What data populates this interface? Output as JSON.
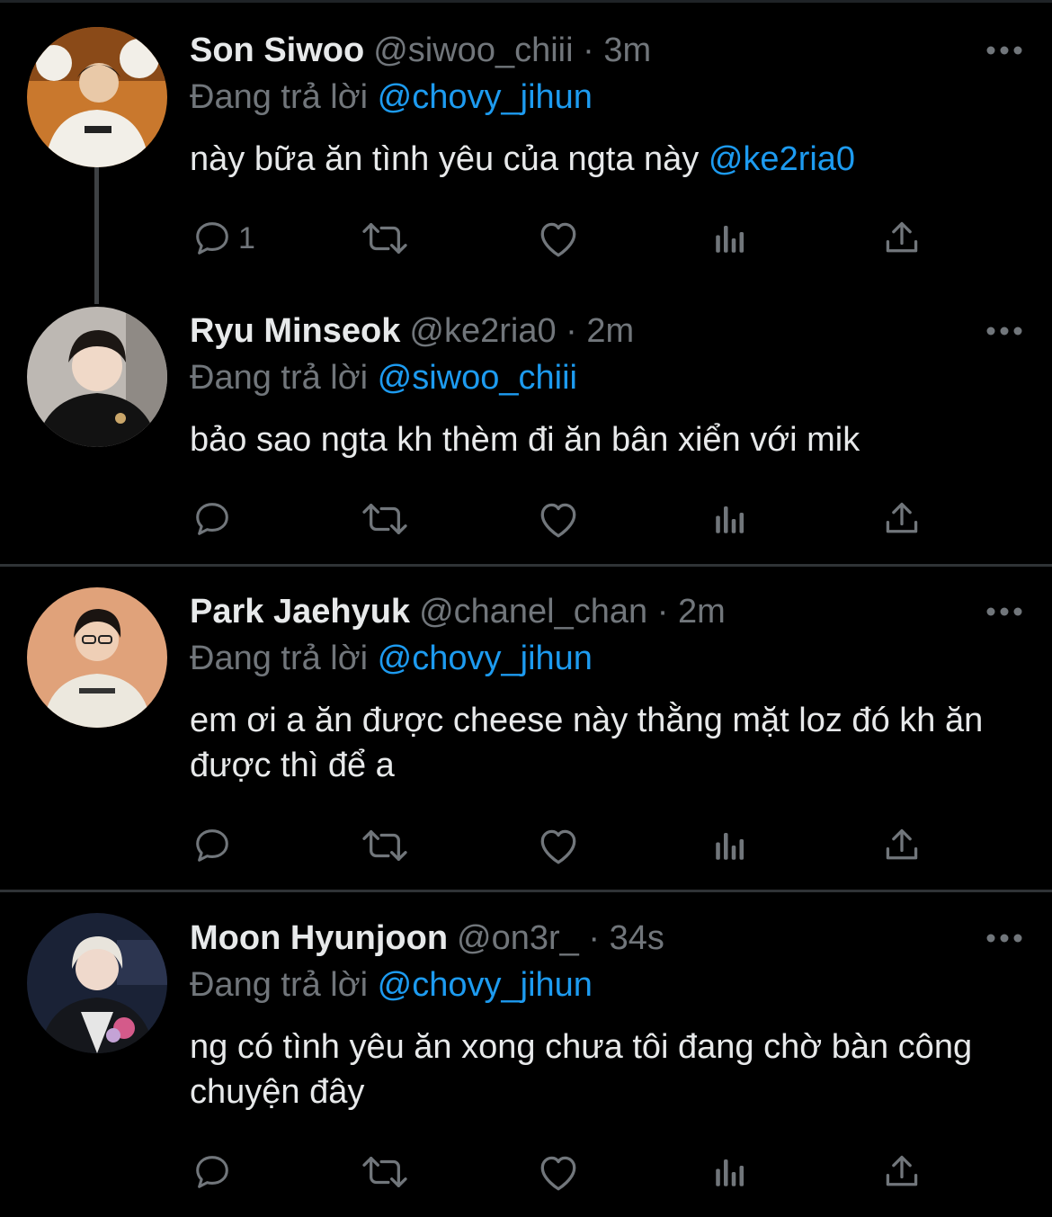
{
  "tweets": [
    {
      "name": "Son Siwoo",
      "handle": "@siwoo_chiii",
      "time": "3m",
      "replying_prefix": "Đang trả lời",
      "replying_to": "@chovy_jihun",
      "text": "này bữa ăn tình yêu của ngta này",
      "text_mention": "@ke2ria0",
      "reply_count": "1",
      "avatar_colors": {
        "bg": "#c9782d",
        "face": "#e9c9a8",
        "shirt": "#f2efe8"
      }
    },
    {
      "name": "Ryu Minseok",
      "handle": "@ke2ria0",
      "time": "2m",
      "replying_prefix": "Đang trả lời",
      "replying_to": "@siwoo_chiii",
      "text": "bảo sao ngta kh thèm đi ăn bân xiển với mik",
      "reply_count": "",
      "avatar_colors": {
        "bg": "#bdb8b3",
        "face": "#f0d9c8",
        "shirt": "#121212"
      }
    },
    {
      "name": "Park Jaehyuk",
      "handle": "@chanel_chan",
      "time": "2m",
      "replying_prefix": "Đang trả lời",
      "replying_to": "@chovy_jihun",
      "text": "em ơi a ăn được cheese này thằng mặt loz đó kh ăn được thì để a",
      "reply_count": "",
      "avatar_colors": {
        "bg": "#e0a27a",
        "face": "#efcfb6",
        "shirt": "#ece8de"
      }
    },
    {
      "name": "Moon Hyunjoon",
      "handle": "@on3r_",
      "time": "34s",
      "replying_prefix": "Đang trả lời",
      "replying_to": "@chovy_jihun",
      "text": "ng có tình yêu ăn xong chưa tôi đang chờ bàn công chuyện đây",
      "reply_count": "",
      "avatar_colors": {
        "bg": "#1a2236",
        "face": "#efd9cc",
        "shirt": "#15171c"
      }
    }
  ],
  "icons": {
    "reply": "reply-icon",
    "retweet": "retweet-icon",
    "like": "heart-icon",
    "views": "views-icon",
    "share": "share-icon",
    "more": "more-icon"
  },
  "colors": {
    "background": "#000000",
    "text": "#e7e9ea",
    "muted": "#71767b",
    "accent": "#1d9bf0",
    "divider": "#2f3336"
  }
}
